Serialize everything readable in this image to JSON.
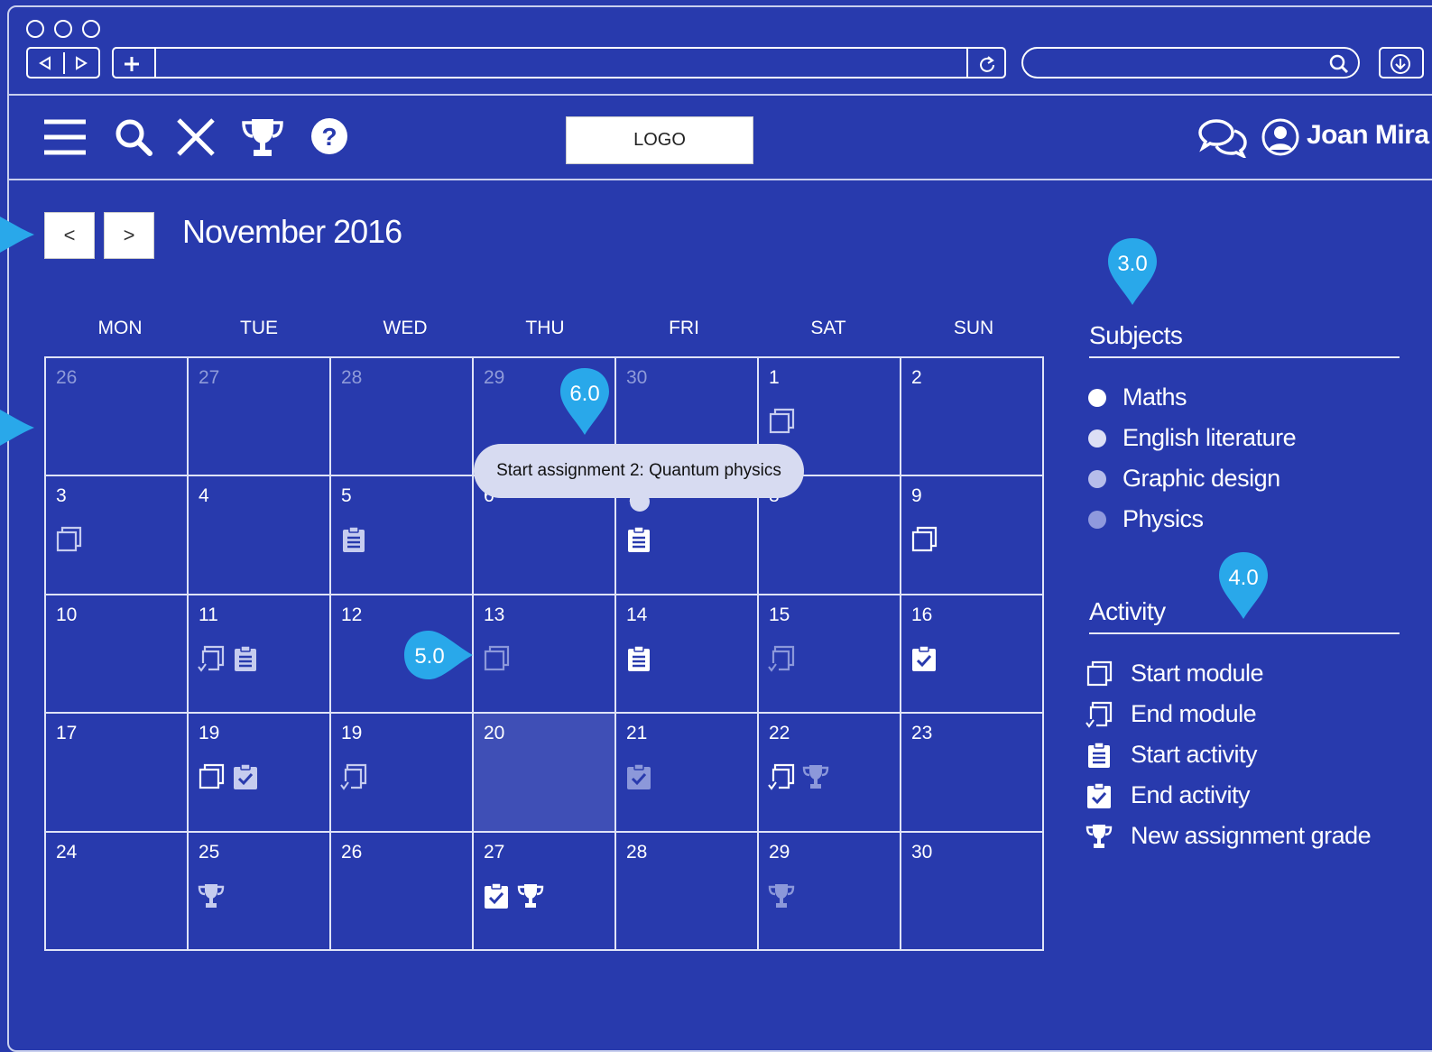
{
  "browser": {
    "window_buttons": [
      "close",
      "minimize",
      "maximize"
    ]
  },
  "header": {
    "logo": "LOGO",
    "user_name": "Joan Mira",
    "icons": [
      "menu-icon",
      "search-icon",
      "close-icon",
      "trophy-icon",
      "help-icon",
      "chat-icon",
      "user-icon"
    ]
  },
  "calendar": {
    "prev_label": "<",
    "next_label": ">",
    "month_title": "November 2016",
    "weekdays": [
      "MON",
      "TUE",
      "WED",
      "THU",
      "FRI",
      "SAT",
      "SUN"
    ],
    "weeks": [
      [
        {
          "day": "26",
          "muted": true,
          "icons": []
        },
        {
          "day": "27",
          "muted": true,
          "icons": []
        },
        {
          "day": "28",
          "muted": true,
          "icons": []
        },
        {
          "day": "29",
          "muted": true,
          "icons": []
        },
        {
          "day": "30",
          "muted": true,
          "icons": []
        },
        {
          "day": "1",
          "icons": [
            {
              "type": "start-module",
              "tone": "light"
            }
          ]
        },
        {
          "day": "2",
          "icons": []
        }
      ],
      [
        {
          "day": "3",
          "icons": [
            {
              "type": "start-module",
              "tone": "light"
            }
          ]
        },
        {
          "day": "4",
          "icons": []
        },
        {
          "day": "5",
          "icons": [
            {
              "type": "start-activity",
              "tone": "light"
            }
          ]
        },
        {
          "day": "6",
          "icons": []
        },
        {
          "day": "7",
          "icons": [
            {
              "type": "start-activity",
              "tone": "white"
            }
          ]
        },
        {
          "day": "8",
          "icons": []
        },
        {
          "day": "9",
          "icons": [
            {
              "type": "start-module",
              "tone": "white"
            }
          ]
        }
      ],
      [
        {
          "day": "10",
          "icons": []
        },
        {
          "day": "11",
          "icons": [
            {
              "type": "end-module",
              "tone": "light"
            },
            {
              "type": "start-activity",
              "tone": "light"
            }
          ]
        },
        {
          "day": "12",
          "icons": []
        },
        {
          "day": "13",
          "icons": [
            {
              "type": "start-module",
              "tone": "dim"
            }
          ]
        },
        {
          "day": "14",
          "icons": [
            {
              "type": "start-activity",
              "tone": "white"
            }
          ]
        },
        {
          "day": "15",
          "icons": [
            {
              "type": "end-module",
              "tone": "dim"
            }
          ]
        },
        {
          "day": "16",
          "icons": [
            {
              "type": "end-activity",
              "tone": "white"
            }
          ]
        }
      ],
      [
        {
          "day": "17",
          "icons": []
        },
        {
          "day": "19",
          "icons": [
            {
              "type": "start-module",
              "tone": "white"
            },
            {
              "type": "end-activity",
              "tone": "light"
            }
          ]
        },
        {
          "day": "19",
          "icons": [
            {
              "type": "end-module",
              "tone": "light"
            }
          ]
        },
        {
          "day": "20",
          "today": true,
          "icons": []
        },
        {
          "day": "21",
          "icons": [
            {
              "type": "end-activity",
              "tone": "dim"
            }
          ]
        },
        {
          "day": "22",
          "icons": [
            {
              "type": "end-module",
              "tone": "white"
            },
            {
              "type": "trophy",
              "tone": "dim"
            }
          ]
        },
        {
          "day": "23",
          "icons": []
        }
      ],
      [
        {
          "day": "24",
          "icons": []
        },
        {
          "day": "25",
          "icons": [
            {
              "type": "trophy",
              "tone": "light"
            }
          ]
        },
        {
          "day": "26",
          "icons": []
        },
        {
          "day": "27",
          "icons": [
            {
              "type": "end-activity",
              "tone": "white"
            },
            {
              "type": "trophy",
              "tone": "white"
            }
          ]
        },
        {
          "day": "28",
          "icons": []
        },
        {
          "day": "29",
          "icons": [
            {
              "type": "trophy",
              "tone": "dim"
            }
          ]
        },
        {
          "day": "30",
          "icons": []
        }
      ]
    ],
    "tooltip": "Start assignment 2: Quantum physics"
  },
  "subjects": {
    "title": "Subjects",
    "items": [
      {
        "label": "Maths",
        "color": "#ffffff"
      },
      {
        "label": "English literature",
        "color": "#dcdff5"
      },
      {
        "label": "Graphic design",
        "color": "#b6bdea"
      },
      {
        "label": "Physics",
        "color": "#8f99dd"
      }
    ]
  },
  "activity": {
    "title": "Activity",
    "items": [
      {
        "label": "Start module",
        "icon": "start-module"
      },
      {
        "label": "End module",
        "icon": "end-module"
      },
      {
        "label": "Start activity",
        "icon": "start-activity"
      },
      {
        "label": "End activity",
        "icon": "end-activity"
      },
      {
        "label": "New assignment grade",
        "icon": "trophy"
      }
    ]
  },
  "annotations": [
    "3.0",
    "4.0",
    "5.0",
    "6.0"
  ],
  "colors": {
    "background": "#283aad",
    "marker": "#29a8ea",
    "today": "#3f4fb6",
    "tooltip": "#d7dbf1"
  }
}
